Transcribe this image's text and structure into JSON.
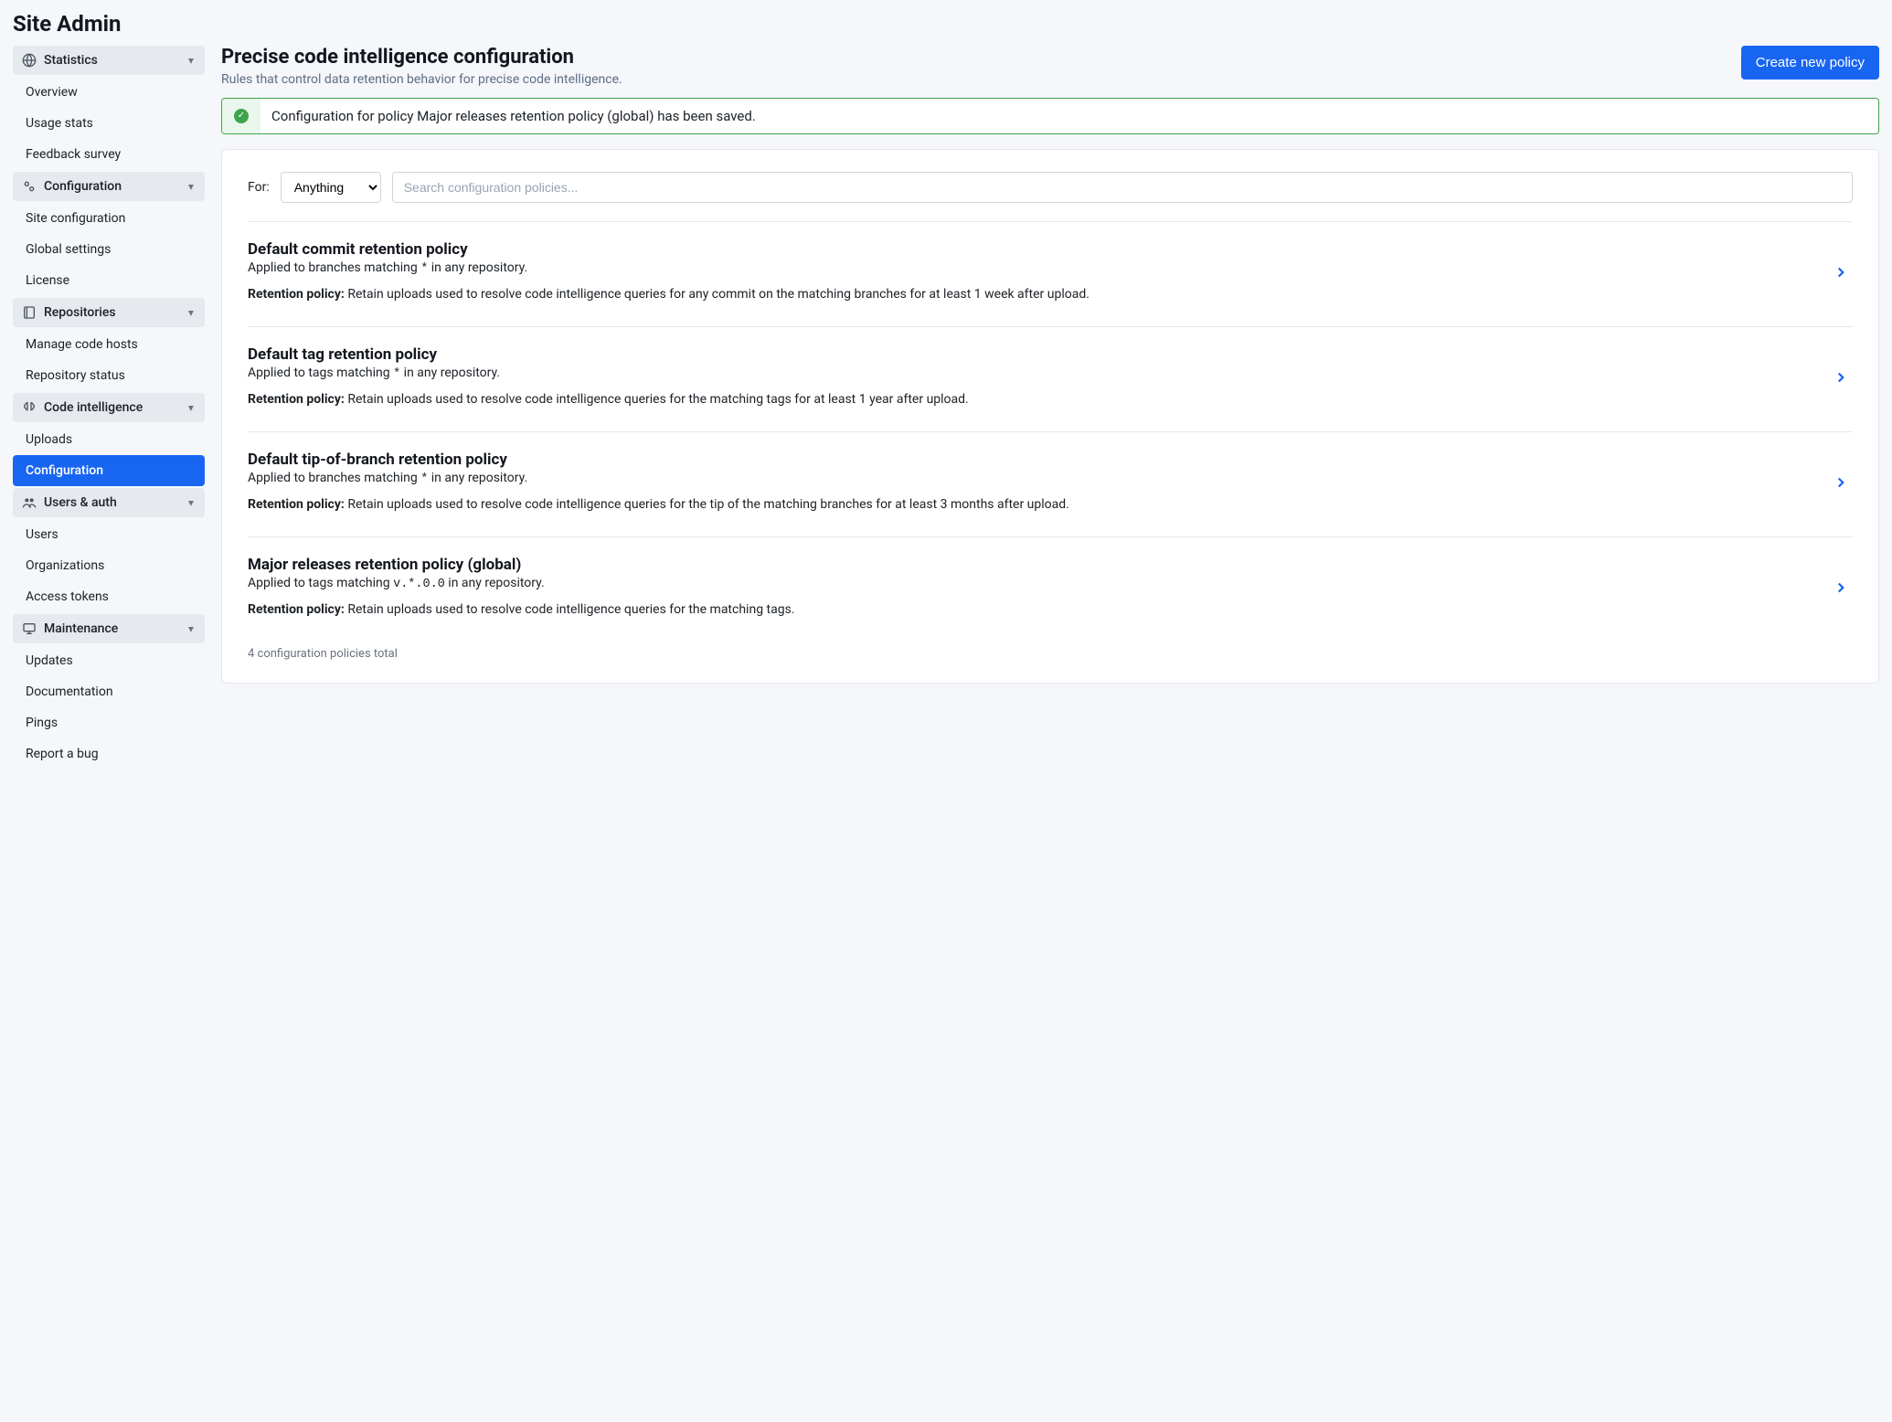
{
  "page_title": "Site Admin",
  "sidebar": {
    "groups": [
      {
        "icon": "globe-icon",
        "label": "Statistics",
        "items": [
          {
            "label": "Overview"
          },
          {
            "label": "Usage stats"
          },
          {
            "label": "Feedback survey"
          }
        ]
      },
      {
        "icon": "cogs-icon",
        "label": "Configuration",
        "items": [
          {
            "label": "Site configuration"
          },
          {
            "label": "Global settings"
          },
          {
            "label": "License"
          }
        ]
      },
      {
        "icon": "repo-icon",
        "label": "Repositories",
        "items": [
          {
            "label": "Manage code hosts"
          },
          {
            "label": "Repository status"
          }
        ]
      },
      {
        "icon": "brain-icon",
        "label": "Code intelligence",
        "items": [
          {
            "label": "Uploads"
          },
          {
            "label": "Configuration",
            "active": true
          }
        ]
      },
      {
        "icon": "users-icon",
        "label": "Users & auth",
        "items": [
          {
            "label": "Users"
          },
          {
            "label": "Organizations"
          },
          {
            "label": "Access tokens"
          }
        ]
      },
      {
        "icon": "monitor-icon",
        "label": "Maintenance",
        "items": [
          {
            "label": "Updates"
          },
          {
            "label": "Documentation"
          },
          {
            "label": "Pings"
          },
          {
            "label": "Report a bug"
          }
        ]
      }
    ]
  },
  "main": {
    "heading": "Precise code intelligence configuration",
    "subheading": "Rules that control data retention behavior for precise code intelligence.",
    "create_button": "Create new policy",
    "alert": "Configuration for policy Major releases retention policy (global) has been saved.",
    "filter": {
      "for_label": "For:",
      "selected": "Anything",
      "options": [
        "Anything"
      ],
      "search_placeholder": "Search configuration policies..."
    },
    "retention_label": "Retention policy:",
    "policies": [
      {
        "title": "Default commit retention policy",
        "applied_prefix": "Applied to branches matching ",
        "pattern": "*",
        "applied_suffix": " in any repository.",
        "retention": "Retain uploads used to resolve code intelligence queries for any commit on the matching branches for at least 1 week after upload."
      },
      {
        "title": "Default tag retention policy",
        "applied_prefix": "Applied to tags matching ",
        "pattern": "*",
        "applied_suffix": " in any repository.",
        "retention": "Retain uploads used to resolve code intelligence queries for the matching tags for at least 1 year after upload."
      },
      {
        "title": "Default tip-of-branch retention policy",
        "applied_prefix": "Applied to branches matching ",
        "pattern": "*",
        "applied_suffix": " in any repository.",
        "retention": "Retain uploads used to resolve code intelligence queries for the tip of the matching branches for at least 3 months after upload."
      },
      {
        "title": "Major releases retention policy (global)",
        "applied_prefix": "Applied to tags matching ",
        "pattern": "v.*.0.0",
        "applied_suffix": " in any repository.",
        "retention": "Retain uploads used to resolve code intelligence queries for the matching tags."
      }
    ],
    "footer": "4 configuration policies total"
  }
}
